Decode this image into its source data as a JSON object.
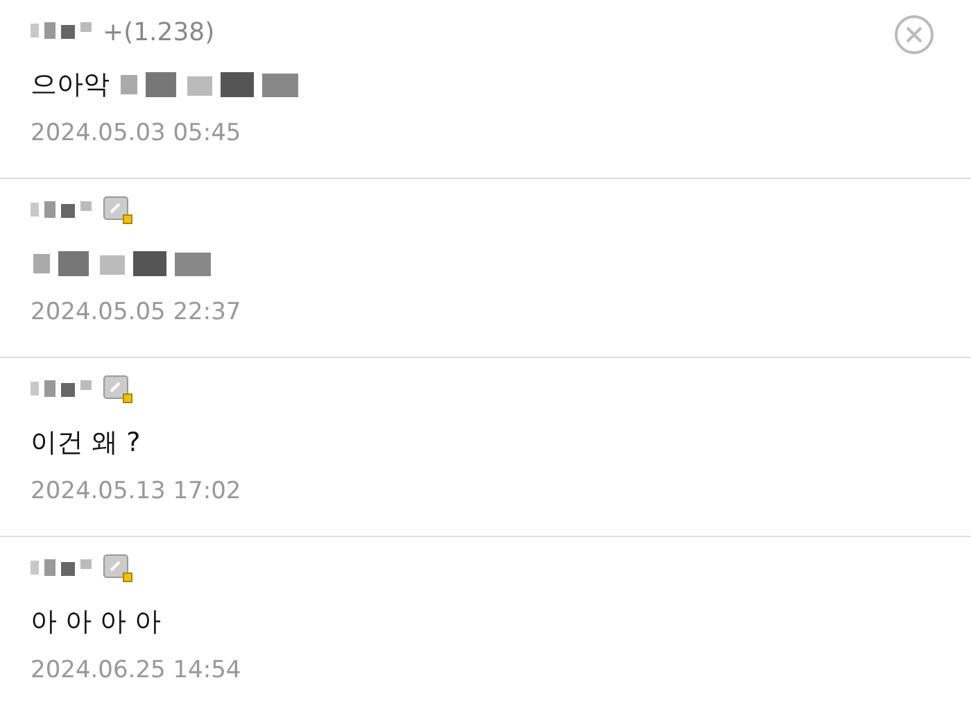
{
  "comments": [
    {
      "author_suffix": "+(1.238)",
      "badge": false,
      "body": "으아악",
      "body_redacted": true,
      "time": "2024.05.03 05:45"
    },
    {
      "badge": true,
      "body_redacted": true,
      "time": "2024.05.05 22:37"
    },
    {
      "badge": true,
      "body": "이건 왜 ?",
      "body_redacted": false,
      "time": "2024.05.13 17:02"
    },
    {
      "badge": true,
      "body": "아 아 아 아",
      "body_redacted": false,
      "time": "2024.06.25 14:54"
    }
  ]
}
